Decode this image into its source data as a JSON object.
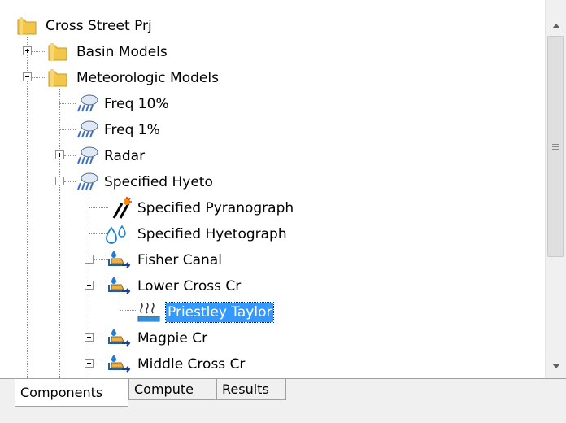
{
  "tree": {
    "root": "Cross Street Prj",
    "basin_models": "Basin Models",
    "meteorologic_models": "Meteorologic Models",
    "freq10": "Freq 10%",
    "freq1": "Freq 1%",
    "radar": "Radar",
    "specified_hyeto": "Specified Hyeto",
    "specified_pyranograph": "Specified Pyranograph",
    "specified_hyetograph": "Specified Hyetograph",
    "fisher_canal": "Fisher Canal",
    "lower_cross_cr": "Lower Cross Cr",
    "priestley_taylor": "Priestley Taylor",
    "magpie_cr": "Magpie Cr",
    "middle_cross_cr": "Middle Cross Cr"
  },
  "tabs": [
    "Components",
    "Compute",
    "Results"
  ],
  "icons": {
    "folder": "folder-icon",
    "met": "rain-cloud-icon",
    "pyranograph": "solar-radiation-icon",
    "hyetograph": "water-drops-icon",
    "subbasin": "subbasin-icon",
    "et": "evapotranspiration-icon"
  },
  "colors": {
    "selection": "#3399ff",
    "folder": "#f3c64a"
  }
}
